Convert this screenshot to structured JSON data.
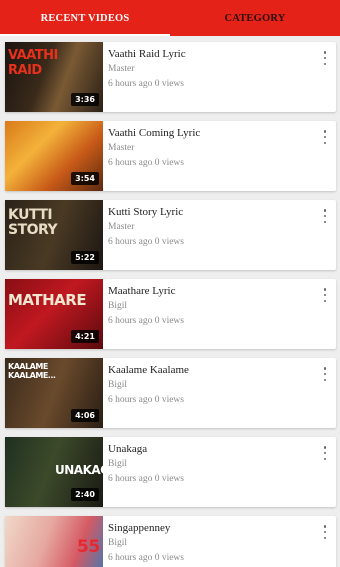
{
  "tabs": {
    "recent": "RECENT VIDEOS",
    "category": "CATEGORY"
  },
  "videos": [
    {
      "title": "Vaathi Raid Lyric",
      "movie": "Master",
      "meta": "6 hours ago 0 views",
      "duration": "3:36",
      "thumb_text": "VAATHI RAID"
    },
    {
      "title": "Vaathi Coming Lyric",
      "movie": "Master",
      "meta": "6 hours ago 0 views",
      "duration": "3:54",
      "thumb_text": ""
    },
    {
      "title": "Kutti Story Lyric",
      "movie": "Master",
      "meta": "6 hours ago 0 views",
      "duration": "5:22",
      "thumb_text": "KUTTI STORY"
    },
    {
      "title": "Maathare Lyric",
      "movie": "Bigil",
      "meta": "6 hours ago 0 views",
      "duration": "4:21",
      "thumb_text": "MATHARE"
    },
    {
      "title": "Kaalame Kaalame",
      "movie": "Bigil",
      "meta": "6 hours ago 0 views",
      "duration": "4:06",
      "thumb_text": "KAALAME KAALAME..."
    },
    {
      "title": "Unakaga",
      "movie": "Bigil",
      "meta": "6 hours ago 0 views",
      "duration": "2:40",
      "thumb_text": "UNAKAG"
    },
    {
      "title": "Singappenney",
      "movie": "Bigil",
      "meta": "6 hours ago 0 views",
      "duration": "",
      "thumb_text": "55"
    }
  ]
}
